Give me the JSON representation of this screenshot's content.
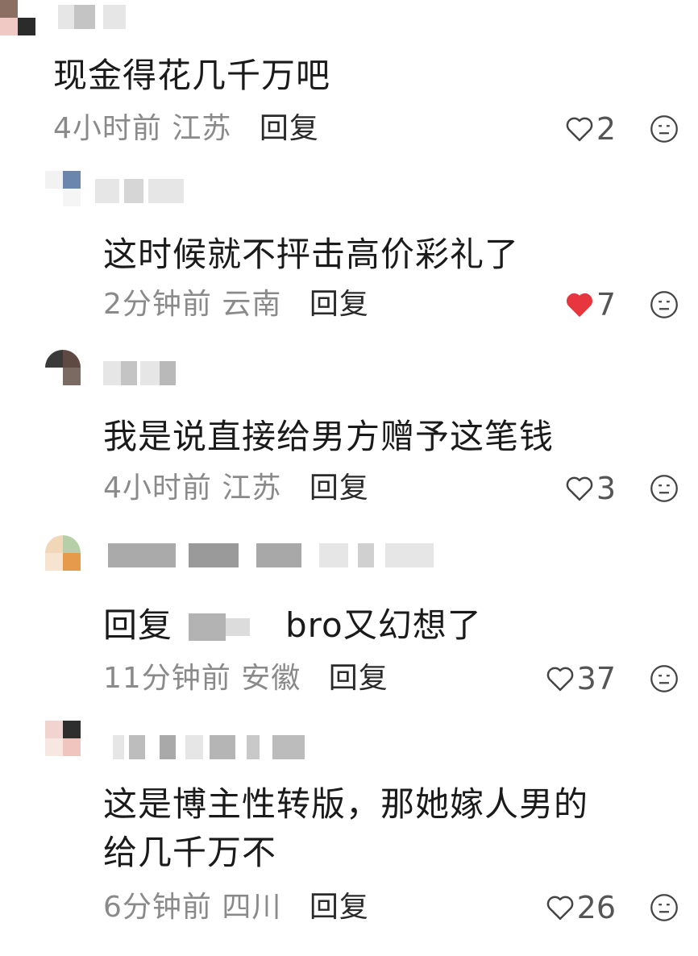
{
  "comments": [
    {
      "text": "现金得花几千万吧",
      "time": "4小时前",
      "location": "江苏",
      "reply_label": "回复",
      "likes": "2",
      "liked": false
    },
    {
      "text": "这时候就不抨击高价彩礼了",
      "time": "2分钟前",
      "location": "云南",
      "reply_label": "回复",
      "likes": "7",
      "liked": true
    },
    {
      "text": "我是说直接给男方赠予这笔钱",
      "time": "4小时前",
      "location": "江苏",
      "reply_label": "回复",
      "likes": "3",
      "liked": false
    },
    {
      "reply_prefix": "回复",
      "text": "bro又幻想了",
      "time": "11分钟前",
      "location": "安徽",
      "reply_label": "回复",
      "likes": "37",
      "liked": false
    },
    {
      "text_line1": "这是博主性转版，那她嫁人男的",
      "text_line2": "给几千万不",
      "time": "6分钟前",
      "location": "四川",
      "reply_label": "回复",
      "likes": "26",
      "liked": false
    }
  ],
  "icons": {
    "like": "heart-outline-icon",
    "liked": "heart-filled-icon",
    "emoji": "emoji-face-icon"
  },
  "colors": {
    "liked_heart": "#e8363f",
    "meta_gray": "#8a8a8a",
    "text_dark": "#1a1a1a"
  }
}
